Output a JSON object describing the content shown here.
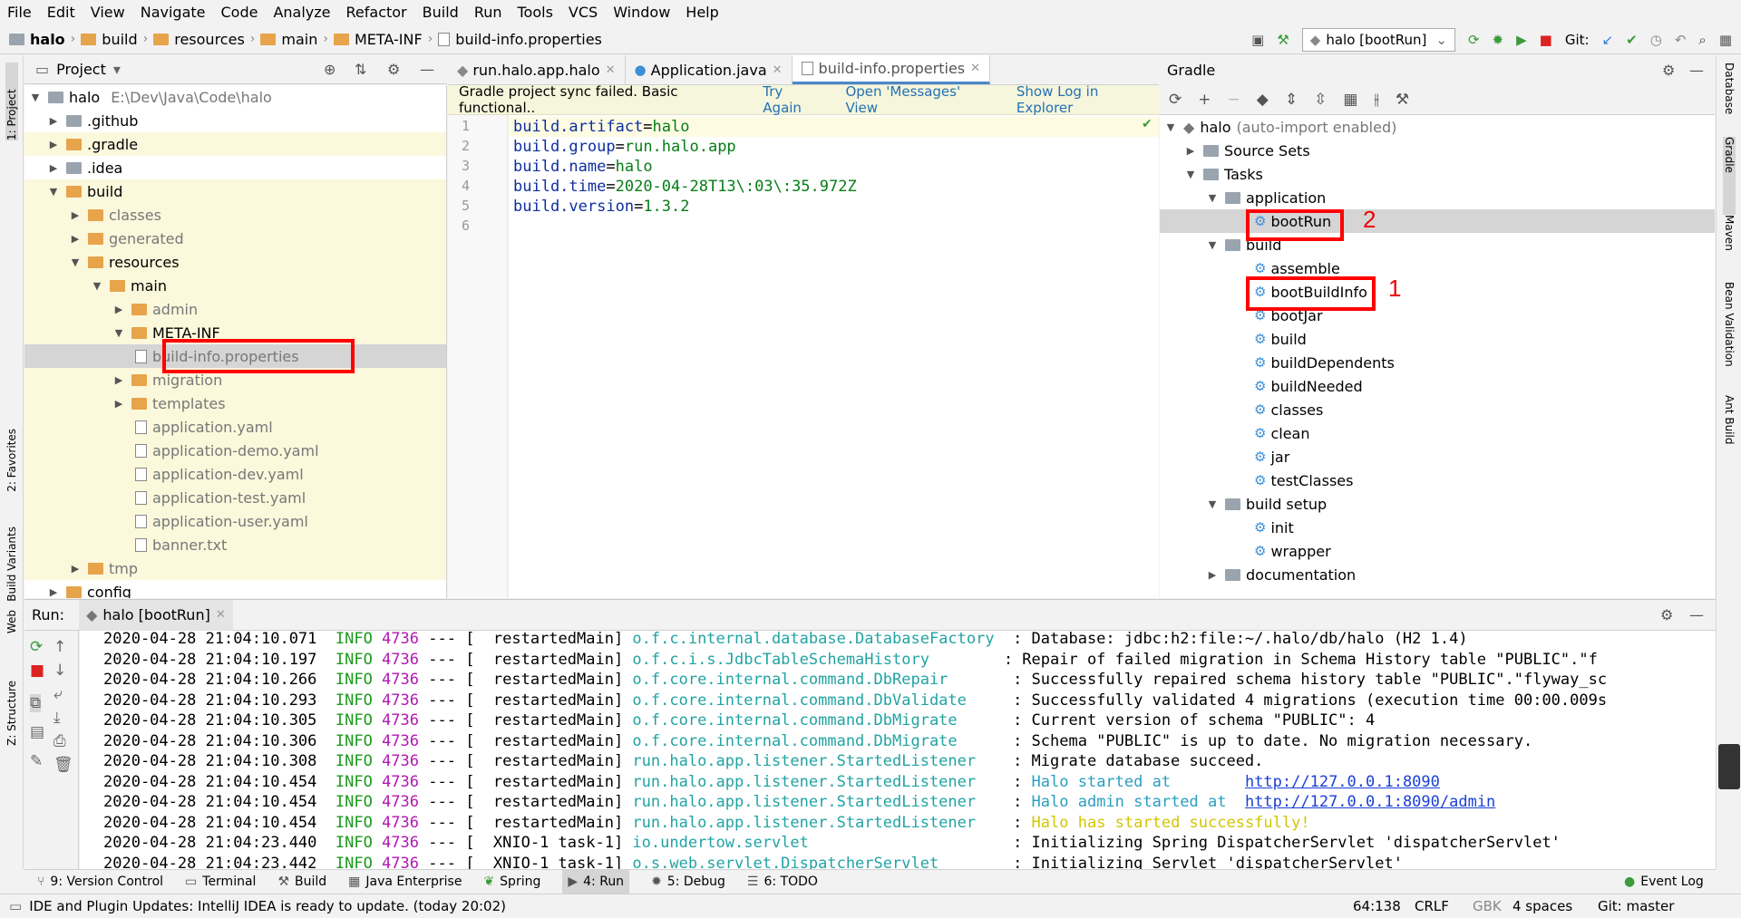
{
  "menu": [
    "File",
    "Edit",
    "View",
    "Navigate",
    "Code",
    "Analyze",
    "Refactor",
    "Build",
    "Run",
    "Tools",
    "VCS",
    "Window",
    "Help"
  ],
  "breadcrumb": [
    "halo",
    "build",
    "resources",
    "main",
    "META-INF",
    "build-info.properties"
  ],
  "toolbar": {
    "run_config": "halo [bootRun]",
    "git_label": "Git:"
  },
  "left_strip": {
    "project": "1: Project",
    "favorites": "2: Favorites",
    "build_variants": "Build Variants",
    "web": "Web",
    "structure": "Z: Structure"
  },
  "right_strip": {
    "database": "Database",
    "gradle": "Gradle",
    "maven": "Maven",
    "bean_validation": "Bean Validation",
    "ant_build": "Ant Build"
  },
  "project": {
    "title": "Project",
    "tree": [
      {
        "label": "halo",
        "extra": "E:\\Dev\\Java\\Code\\halo"
      },
      {
        "label": ".github"
      },
      {
        "label": ".gradle"
      },
      {
        "label": ".idea"
      },
      {
        "label": "build"
      },
      {
        "label": "classes"
      },
      {
        "label": "generated"
      },
      {
        "label": "resources"
      },
      {
        "label": "main"
      },
      {
        "label": "admin"
      },
      {
        "label": "META-INF"
      },
      {
        "label": "build-info.properties"
      },
      {
        "label": "migration"
      },
      {
        "label": "templates"
      },
      {
        "label": "application.yaml"
      },
      {
        "label": "application-demo.yaml"
      },
      {
        "label": "application-dev.yaml"
      },
      {
        "label": "application-test.yaml"
      },
      {
        "label": "application-user.yaml"
      },
      {
        "label": "banner.txt"
      },
      {
        "label": "tmp"
      },
      {
        "label": "config"
      }
    ]
  },
  "editor": {
    "tabs": [
      "run.halo.app.halo",
      "Application.java",
      "build-info.properties"
    ],
    "sync_message": "Gradle project sync failed. Basic functional..",
    "sync_links": [
      "Try Again",
      "Open 'Messages' View",
      "Show Log in Explorer"
    ],
    "line_numbers": [
      "1",
      "2",
      "3",
      "4",
      "5",
      "6"
    ],
    "lines": [
      {
        "key": "build.artifact",
        "value": "halo"
      },
      {
        "key": "build.group",
        "value": "run.halo.app"
      },
      {
        "key": "build.name",
        "value": "halo"
      },
      {
        "key": "build.time",
        "value": "2020-04-28T13\\:03\\:35.972Z"
      },
      {
        "key": "build.version",
        "value": "1.3.2"
      }
    ]
  },
  "gradle": {
    "title": "Gradle",
    "root_label": "halo",
    "root_extra": "(auto-import enabled)",
    "tree": [
      "Source Sets",
      "Tasks",
      "application",
      "bootRun",
      "build",
      "assemble",
      "bootBuildInfo",
      "bootJar",
      "build",
      "buildDependents",
      "buildNeeded",
      "classes",
      "clean",
      "jar",
      "testClasses",
      "build setup",
      "init",
      "wrapper",
      "documentation"
    ],
    "markers": [
      "2",
      "1"
    ]
  },
  "run": {
    "label": "Run:",
    "tab": "halo [bootRun]",
    "log": [
      {
        "ts": "2020-04-28 21:04:10.071",
        "lvl": "INFO",
        "pid": "4736",
        "sep": "---",
        "thread": "[  restartedMain]",
        "logger": "o.f.c.internal.database.DatabaseFactory ",
        "msg": ": Database: jdbc:h2:file:~/.halo/db/halo (H2 1.4)"
      },
      {
        "ts": "2020-04-28 21:04:10.197",
        "lvl": "INFO",
        "pid": "4736",
        "sep": "---",
        "thread": "[  restartedMain]",
        "logger": "o.f.c.i.s.JdbcTableSchemaHistory       ",
        "msg": ": Repair of failed migration in Schema History table \"PUBLIC\".\"f"
      },
      {
        "ts": "2020-04-28 21:04:10.266",
        "lvl": "INFO",
        "pid": "4736",
        "sep": "---",
        "thread": "[  restartedMain]",
        "logger": "o.f.core.internal.command.DbRepair      ",
        "msg": ": Successfully repaired schema history table \"PUBLIC\".\"flyway_sc"
      },
      {
        "ts": "2020-04-28 21:04:10.293",
        "lvl": "INFO",
        "pid": "4736",
        "sep": "---",
        "thread": "[  restartedMain]",
        "logger": "o.f.core.internal.command.DbValidate    ",
        "msg": ": Successfully validated 4 migrations (execution time 00:00.009s"
      },
      {
        "ts": "2020-04-28 21:04:10.305",
        "lvl": "INFO",
        "pid": "4736",
        "sep": "---",
        "thread": "[  restartedMain]",
        "logger": "o.f.core.internal.command.DbMigrate     ",
        "msg": ": Current version of schema \"PUBLIC\": 4"
      },
      {
        "ts": "2020-04-28 21:04:10.306",
        "lvl": "INFO",
        "pid": "4736",
        "sep": "---",
        "thread": "[  restartedMain]",
        "logger": "o.f.core.internal.command.DbMigrate     ",
        "msg": ": Schema \"PUBLIC\" is up to date. No migration necessary."
      },
      {
        "ts": "2020-04-28 21:04:10.308",
        "lvl": "INFO",
        "pid": "4736",
        "sep": "---",
        "thread": "[  restartedMain]",
        "logger": "run.halo.app.listener.StartedListener   ",
        "msg": ": Migrate database succeed."
      },
      {
        "ts": "2020-04-28 21:04:10.454",
        "lvl": "INFO",
        "pid": "4736",
        "sep": "---",
        "thread": "[  restartedMain]",
        "logger": "run.halo.app.listener.StartedListener   ",
        "msg": ": ",
        "hl": "Halo started at        ",
        "link": "http://127.0.0.1:8090"
      },
      {
        "ts": "2020-04-28 21:04:10.454",
        "lvl": "INFO",
        "pid": "4736",
        "sep": "---",
        "thread": "[  restartedMain]",
        "logger": "run.halo.app.listener.StartedListener   ",
        "msg": ": ",
        "hl": "Halo admin started at  ",
        "link": "http://127.0.0.1:8090/admin"
      },
      {
        "ts": "2020-04-28 21:04:10.454",
        "lvl": "INFO",
        "pid": "4736",
        "sep": "---",
        "thread": "[  restartedMain]",
        "logger": "run.halo.app.listener.StartedListener   ",
        "msg": ": ",
        "okmsg": "Halo has started successfully!"
      },
      {
        "ts": "2020-04-28 21:04:23.440",
        "lvl": "INFO",
        "pid": "4736",
        "sep": "---",
        "thread": "[  XNIO-1 task-1]",
        "logger": "io.undertow.servlet                     ",
        "msg": ": Initializing Spring DispatcherServlet 'dispatcherServlet'"
      },
      {
        "ts": "2020-04-28 21:04:23.442",
        "lvl": "INFO",
        "pid": "4736",
        "sep": "---",
        "thread": "[  XNIO-1 task-1]",
        "logger": "o.s.web.servlet.DispatcherServlet       ",
        "msg": ": Initializing Servlet 'dispatcherServlet'"
      }
    ]
  },
  "bottom_tabs": [
    "9: Version Control",
    "Terminal",
    "Build",
    "Java Enterprise",
    "Spring",
    "4: Run",
    "5: Debug",
    "6: TODO"
  ],
  "event_log": "Event Log",
  "status": {
    "message": "IDE and Plugin Updates: IntelliJ IDEA is ready to update. (today 20:02)",
    "position": "64:138",
    "line_sep": "CRLF",
    "encoding": "GBK",
    "indent": "4 spaces",
    "git": "Git: master"
  },
  "colors": {
    "accent": "#4a88c7",
    "highlight_box": "#ff0000",
    "link": "#2470b3"
  }
}
